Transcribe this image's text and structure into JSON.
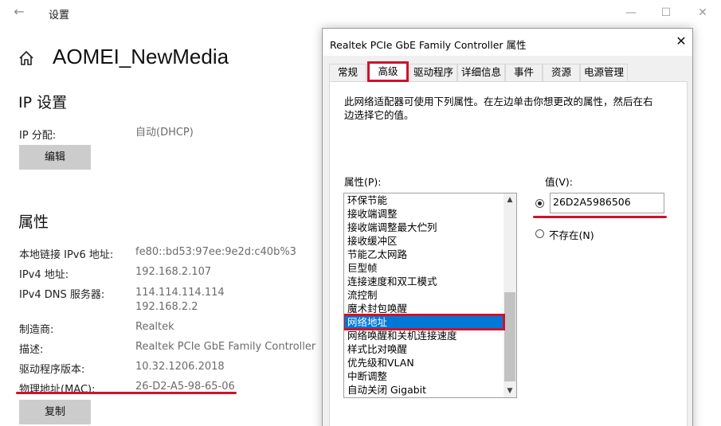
{
  "settings": {
    "window_title": "设置",
    "device_name": "AOMEI_NewMedia",
    "ip_section": {
      "title": "IP 设置",
      "assignment_label": "IP 分配:",
      "assignment_value": "自动(DHCP)",
      "edit_button": "编辑"
    },
    "properties_section": {
      "title": "属性",
      "rows": [
        {
          "label": "本地链接 IPv6 地址:",
          "value": "fe80::bd53:97ee:9e2d:c40b%3"
        },
        {
          "label": "IPv4 地址:",
          "value": "192.168.2.107"
        },
        {
          "label": "IPv4 DNS 服务器:",
          "value": "114.114.114.114",
          "value2": "192.168.2.2"
        },
        {
          "label": "制造商:",
          "value": "Realtek"
        },
        {
          "label": "描述:",
          "value": "Realtek PCIe GbE Family Controller"
        },
        {
          "label": "驱动程序版本:",
          "value": "10.32.1206.2018"
        },
        {
          "label": "物理地址(MAC):",
          "value": "26-D2-A5-98-65-06"
        }
      ],
      "copy_button": "复制"
    }
  },
  "dialog": {
    "title": "Realtek PCIe GbE Family Controller 属性",
    "tabs": [
      {
        "label": "常规",
        "active": false
      },
      {
        "label": "高级",
        "active": true
      },
      {
        "label": "驱动程序",
        "active": false
      },
      {
        "label": "详细信息",
        "active": false
      },
      {
        "label": "事件",
        "active": false
      },
      {
        "label": "资源",
        "active": false
      },
      {
        "label": "电源管理",
        "active": false
      }
    ],
    "description": "此网络适配器可使用下列属性。在左边单击你想更改的属性，然后在右边选择它的值。",
    "property_label": "属性(P):",
    "value_label": "值(V):",
    "properties": [
      "环保节能",
      "接收端调整",
      "接收端调整最大伫列",
      "接收缓冲区",
      "节能乙太网路",
      "巨型帧",
      "连接速度和双工模式",
      "流控制",
      "魔术封包唤醒",
      "网络地址",
      "网络唤醒和关机连接速度",
      "样式比对唤醒",
      "优先级和VLAN",
      "中断调整",
      "自动关闭 Gigabit"
    ],
    "selected_property": "网络地址",
    "value_input": "26D2A5986506",
    "not_present_label": "不存在(N)",
    "value_option_selected": "value"
  },
  "colors": {
    "highlight_red": "#d0112b",
    "selection_blue": "#0078d7"
  }
}
